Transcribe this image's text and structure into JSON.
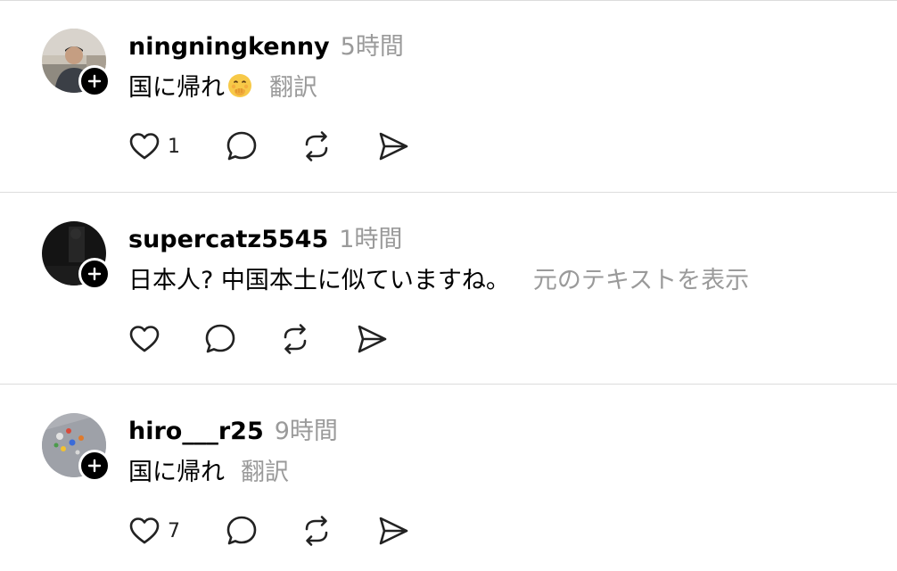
{
  "posts": [
    {
      "username": "ningningkenny",
      "time": "5時間",
      "text": "国に帰れ",
      "has_emoji": true,
      "emoji_icon": "hand-over-mouth-emoji",
      "translate_label": "翻訳",
      "like_count": "1"
    },
    {
      "username": "supercatz5545",
      "time": "1時間",
      "text": "日本人? 中国本土に似ていますね。",
      "has_emoji": false,
      "translate_label": "元のテキストを表示",
      "like_count": ""
    },
    {
      "username": "hiro___r25",
      "time": "9時間",
      "text": "国に帰れ",
      "has_emoji": false,
      "translate_label": "翻訳",
      "like_count": "7"
    }
  ],
  "icons": {
    "like": "heart-icon",
    "comment": "comment-bubble-icon",
    "repost": "repost-icon",
    "share": "send-icon",
    "follow": "plus-icon"
  },
  "colors": {
    "text": "#000000",
    "muted": "#9a9a9a",
    "divider": "#dcdcdc",
    "badge": "#000000"
  }
}
